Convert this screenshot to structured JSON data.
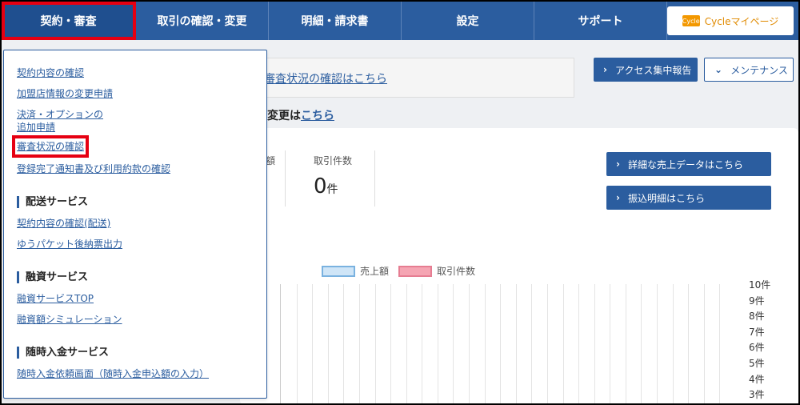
{
  "nav": {
    "items": [
      {
        "label": "契約・審査"
      },
      {
        "label": "取引の確認・変更"
      },
      {
        "label": "明細・請求書"
      },
      {
        "label": "設定"
      },
      {
        "label": "サポート"
      }
    ],
    "cycle_button": "Cycleマイページ",
    "cycle_logo": "Cycle"
  },
  "main": {
    "notice_link": "審査状況の確認はこちら",
    "access_report_button": "アクセス集中報告",
    "maintenance_button": "メンテナンス",
    "change_prefix": "ご変更は",
    "change_link": "こちら",
    "metric_sales_label_partial": "額",
    "metric_count_label": "取引件数",
    "metric_count_value": "0",
    "metric_count_unit": "件",
    "detail_sales_button": "詳細な売上データはこちら",
    "transfer_button": "振込明細はこちら"
  },
  "chart_data": {
    "type": "bar",
    "legend": [
      "売上額",
      "取引件数"
    ],
    "y_ticks_right": [
      "10件",
      "9件",
      "8件",
      "7件",
      "6件",
      "5件",
      "4件",
      "3件"
    ],
    "colors": {
      "sales": "#cfe5f7",
      "sales_border": "#7ab2e0",
      "count": "#f5a5b3",
      "count_border": "#e67d92"
    }
  },
  "dropdown": {
    "links_top": [
      {
        "label": "契約内容の確認"
      },
      {
        "label": "加盟店情報の変更申請"
      },
      {
        "label": "決済・オプションの"
      },
      {
        "label": "追加申請"
      },
      {
        "label": "審査状況の確認"
      },
      {
        "label": "登録完了通知書及び利用約款の確認"
      }
    ],
    "delivery": {
      "heading": "配送サービス",
      "links": [
        {
          "label": "契約内容の確認(配送)"
        },
        {
          "label": "ゆうパケット後納票出力"
        }
      ]
    },
    "finance": {
      "heading": "融資サービス",
      "links": [
        {
          "label": "融資サービスTOP"
        },
        {
          "label": "融資額シミュレーション"
        }
      ]
    },
    "deposit": {
      "heading": "随時入金サービス",
      "links": [
        {
          "label": "随時入金依頼画面（随時入金申込額の入力）"
        }
      ]
    }
  }
}
